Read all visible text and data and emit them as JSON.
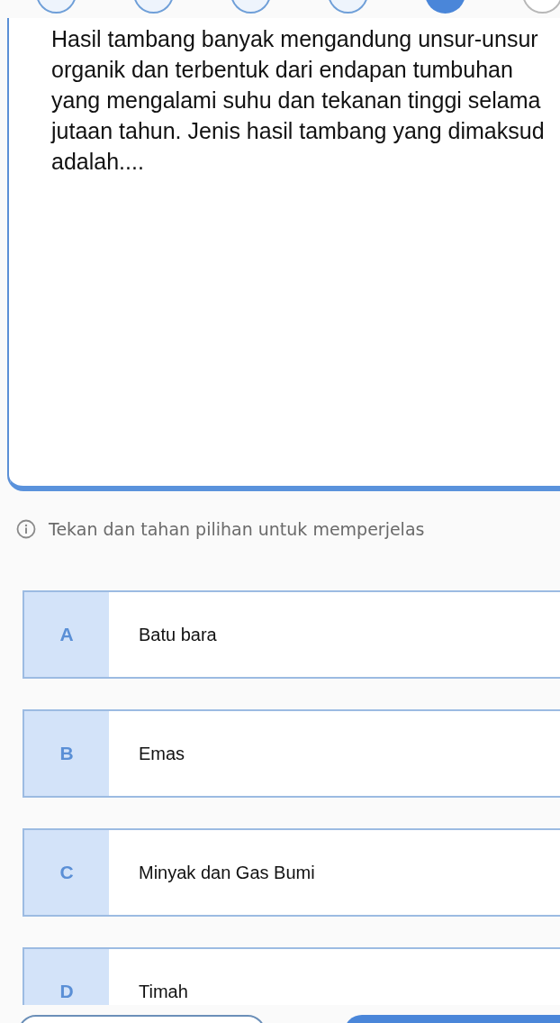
{
  "steps": [
    {
      "kind": "answered"
    },
    {
      "kind": "answered"
    },
    {
      "kind": "answered"
    },
    {
      "kind": "answered"
    },
    {
      "kind": "current"
    },
    {
      "kind": "unanswered"
    }
  ],
  "question": {
    "text": "Hasil tambang banyak mengandung unsur-unsur organik dan terbentuk dari endapan tumbuhan yang mengalami suhu dan tekanan tinggi selama jutaan tahun. Jenis hasil tambang yang dimaksud adalah...."
  },
  "hint": "Tekan dan tahan pilihan untuk memperjelas",
  "options": [
    {
      "letter": "A",
      "text": "Batu bara",
      "selected": false
    },
    {
      "letter": "B",
      "text": "Emas",
      "selected": false
    },
    {
      "letter": "C",
      "text": "Minyak dan Gas Bumi",
      "selected": false
    },
    {
      "letter": "D",
      "text": "Timah",
      "selected": false
    }
  ],
  "nav_buttons": [
    {
      "kind": "outline"
    },
    {
      "kind": "filled"
    }
  ]
}
